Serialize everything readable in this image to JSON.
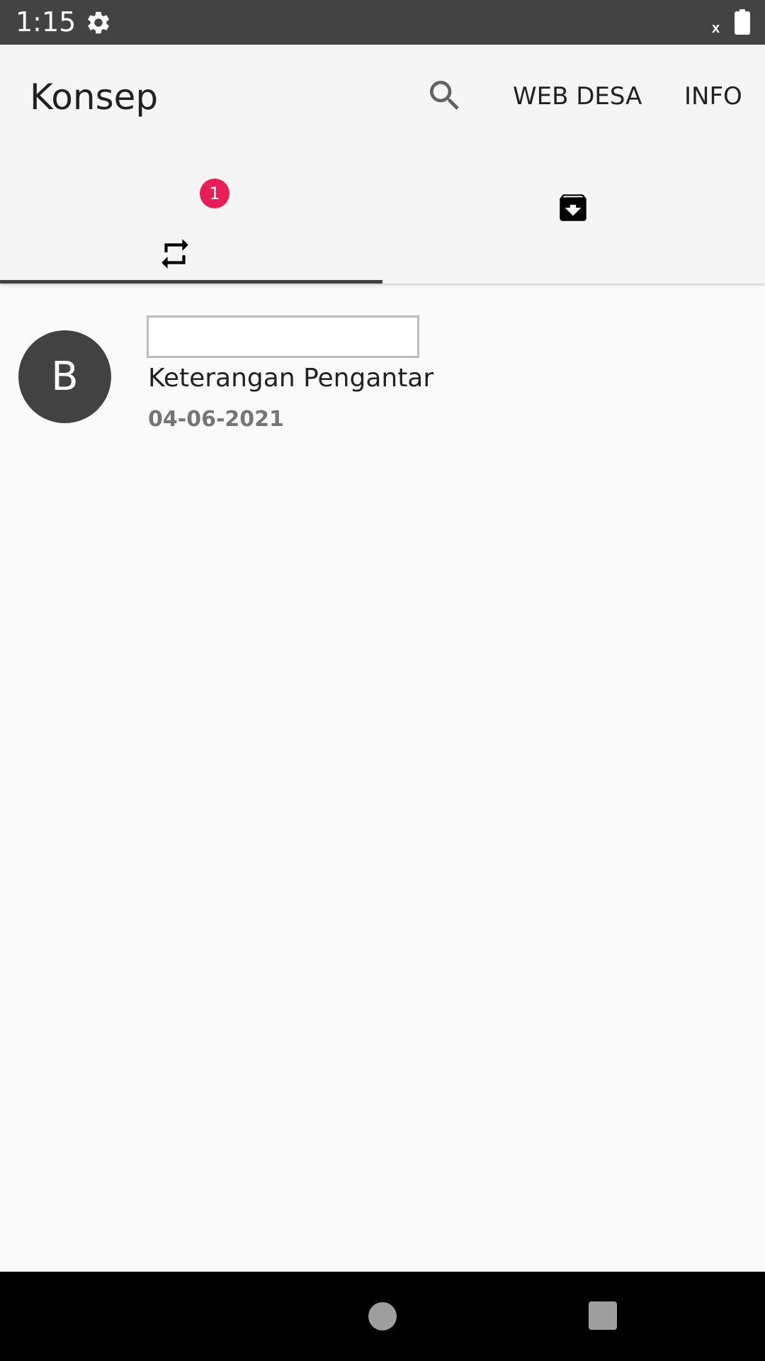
{
  "status_bar": {
    "time": "1:15",
    "signal_text": "x",
    "icons": [
      "settings-gear-icon",
      "battery-icon"
    ]
  },
  "app_bar": {
    "title": "Konsep",
    "search_icon": "search-icon",
    "actions": [
      "WEB DESA",
      "INFO"
    ]
  },
  "tabs": [
    {
      "icon": "repeat-icon",
      "badge": "1",
      "selected": true
    },
    {
      "icon": "archive-download-icon",
      "selected": false
    }
  ],
  "list": {
    "items": [
      {
        "avatar_letter": "B",
        "title": "",
        "subtitle": "Keterangan Pengantar",
        "date": "04-06-2021"
      }
    ]
  },
  "navigation": {
    "icons": [
      "home-button-icon",
      "recents-button-icon"
    ]
  },
  "colors": {
    "status_bar": "#434343",
    "app_bar": "#f5f5f5",
    "background": "#fafafa",
    "badge": "#e91e57",
    "avatar": "#424242",
    "tab_indicator": "#424242"
  }
}
